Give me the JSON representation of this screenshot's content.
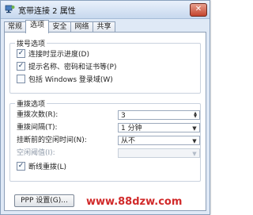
{
  "window": {
    "title": "宽带连接 2 属性",
    "close_glyph": "✕"
  },
  "tabs": [
    {
      "label": "常规",
      "active": false
    },
    {
      "label": "选项",
      "active": true
    },
    {
      "label": "安全",
      "active": false
    },
    {
      "label": "网络",
      "active": false
    },
    {
      "label": "共享",
      "active": false
    }
  ],
  "dial_options": {
    "title": "拨号选项",
    "items": [
      {
        "label": "连接时显示进度(D)",
        "checked": true
      },
      {
        "label": "提示名称、密码和证书等(P)",
        "checked": true
      },
      {
        "label": "包括 Windows 登录域(W)",
        "checked": false,
        "disabled": true
      }
    ]
  },
  "redial_options": {
    "title": "重拨选项",
    "redial_attempts_label": "重拨次数(R):",
    "redial_attempts_value": "3",
    "redial_interval_label": "重拨间隔(T):",
    "redial_interval_value": "1 分钟",
    "idle_disconnect_label": "挂断前的空闲时间(N):",
    "idle_disconnect_value": "从不",
    "idle_threshold_label": "空闲阈值(I):",
    "idle_threshold_value": "",
    "redial_if_dropped_label": "断线重拨(L)",
    "redial_if_dropped_checked": true
  },
  "buttons": {
    "ppp_settings": "PPP 设置(G)..."
  },
  "watermark": {
    "text": "www.88dzw.com"
  },
  "icons": {
    "title": "network-connection-icon",
    "close": "close-icon",
    "dropdown": "chevron-down-icon",
    "spin": "spinner-arrows-icon",
    "check": "check-icon"
  },
  "colors": {
    "title_bar": "#c7d8ee",
    "close_button": "#c4442d",
    "watermark": "#d12a2a"
  }
}
